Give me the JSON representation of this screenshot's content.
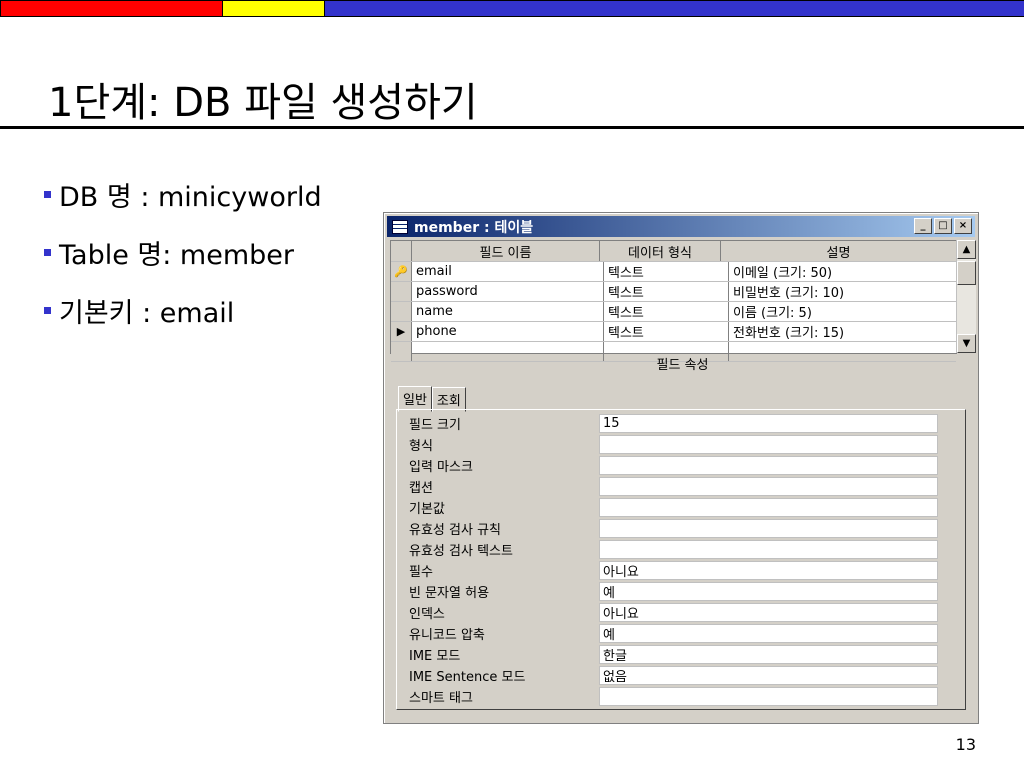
{
  "slide": {
    "title": "1단계: DB 파일 생성하기",
    "bullets": [
      "DB 명 : minicyworld",
      "Table 명: member",
      "기본키 : email"
    ],
    "page_number": "13"
  },
  "window": {
    "title": "member : 테이블",
    "buttons": {
      "minimize": "_",
      "maximize": "□",
      "close": "×"
    }
  },
  "grid": {
    "headers": [
      "필드 이름",
      "데이터 형식",
      "설명"
    ],
    "rows": [
      {
        "name": "email",
        "type": "텍스트",
        "desc": "이메일 (크기:  50)",
        "marker": "🔑"
      },
      {
        "name": "password",
        "type": "텍스트",
        "desc": "비밀번호 (크기: 10)",
        "marker": ""
      },
      {
        "name": "name",
        "type": "텍스트",
        "desc": "이름 (크기: 5)",
        "marker": ""
      },
      {
        "name": "phone",
        "type": "텍스트",
        "desc": "전화번호 (크기: 15)",
        "marker": "▶"
      },
      {
        "name": "",
        "type": "",
        "desc": "",
        "marker": ""
      }
    ]
  },
  "properties": {
    "section_label": "필드 속성",
    "tabs": [
      "일반",
      "조회"
    ],
    "rows": [
      {
        "label": "필드 크기",
        "value": "15"
      },
      {
        "label": "형식",
        "value": ""
      },
      {
        "label": "입력 마스크",
        "value": ""
      },
      {
        "label": "캡션",
        "value": ""
      },
      {
        "label": "기본값",
        "value": ""
      },
      {
        "label": "유효성 검사 규칙",
        "value": ""
      },
      {
        "label": "유효성 검사 텍스트",
        "value": ""
      },
      {
        "label": "필수",
        "value": "아니요"
      },
      {
        "label": "빈 문자열 허용",
        "value": "예"
      },
      {
        "label": "인덱스",
        "value": "아니요"
      },
      {
        "label": "유니코드 압축",
        "value": "예"
      },
      {
        "label": "IME 모드",
        "value": "한글"
      },
      {
        "label": "IME Sentence 모드",
        "value": "없음"
      },
      {
        "label": "스마트 태그",
        "value": ""
      }
    ]
  },
  "colors": {
    "top_red": "#ff0000",
    "top_yellow": "#ffff00",
    "top_blue": "#3333cc",
    "titlebar": "#0a246a"
  }
}
